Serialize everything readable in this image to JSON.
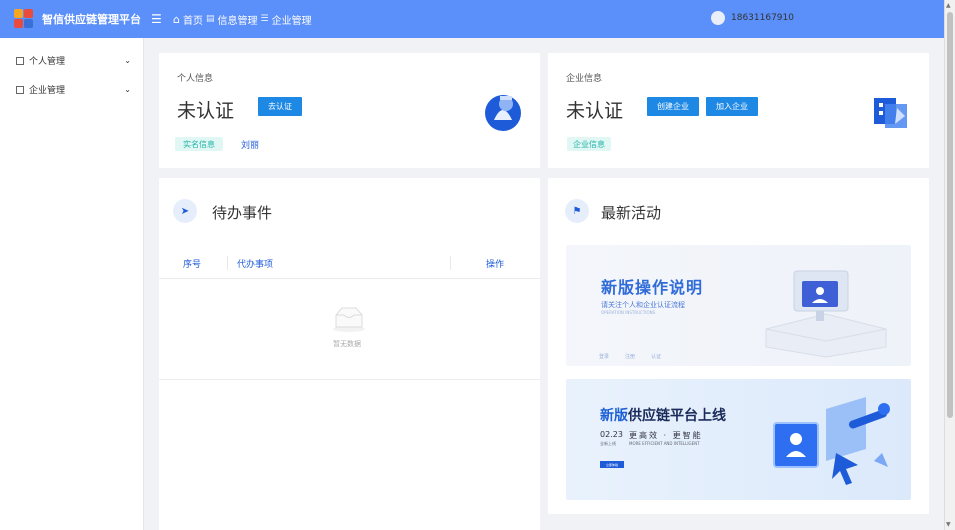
{
  "header": {
    "app_title": "智信供应链管理平台",
    "breadcrumb": [
      "首页",
      "信息管理",
      "企业管理"
    ],
    "user_phone": "18631167910",
    "brand_color": "#5b8ff9"
  },
  "sidebar": {
    "items": [
      {
        "label": "个人管理",
        "icon": "grid-icon"
      },
      {
        "label": "企业管理",
        "icon": "list-icon"
      }
    ]
  },
  "personal": {
    "label": "个人信息",
    "status": "未认证",
    "action": "去认证",
    "tag": "实名信息",
    "link": "刘丽"
  },
  "enterprise": {
    "label": "企业信息",
    "status": "未认证",
    "btn_create": "创建企业",
    "btn_join": "加入企业",
    "tag": "企业信息"
  },
  "todo": {
    "title": "待办事件",
    "columns": [
      "序号",
      "代办事项",
      "操作"
    ],
    "empty": "暂无数据"
  },
  "news": {
    "title": "最新活动",
    "banner1": {
      "title": "新版操作说明",
      "subtitle": "请关注个人和企业认证流程",
      "small": "OPERATION INSTRUCTIONS",
      "tabs": [
        "登录",
        "注册",
        "认证"
      ]
    },
    "banner2": {
      "title_prefix": "新版",
      "title_rest": "供应链平台上线",
      "date": "02.23",
      "date_sub": "全新上线",
      "slogan": "更高效 · 更智能",
      "slogan_en": "MORE EFFICIENT AND INTELLIGENT",
      "button": "立即体验"
    }
  }
}
